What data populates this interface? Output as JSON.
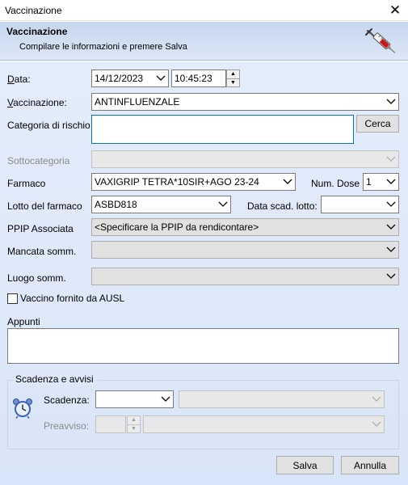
{
  "window": {
    "title": "Vaccinazione",
    "close_glyph": "✕"
  },
  "header": {
    "title": "Vaccinazione",
    "subtitle": "Compilare le informazioni e premere Salva",
    "icon": "syringe-icon",
    "accent": "#c00000"
  },
  "form": {
    "data": {
      "label": "Data:",
      "label_mnemonic": "D",
      "label_rest": "ata:",
      "date": "14/12/2023",
      "time": "10:45:23"
    },
    "vaccinazione": {
      "label": "Vaccinazione:",
      "label_mnemonic": "V",
      "label_rest": "accinazione:",
      "value": "ANTINFLUENZALE"
    },
    "categoria_rischio": {
      "label": "Categoria di rischio",
      "value": "",
      "search_button": "Cerca"
    },
    "sottocategoria": {
      "label": "Sottocategoria",
      "value": ""
    },
    "farmaco": {
      "label": "Farmaco",
      "value": "VAXIGRIP TETRA*10SIR+AGO 23-24"
    },
    "num_dose": {
      "label": "Num. Dose",
      "value": "1"
    },
    "lotto": {
      "label": "Lotto del farmaco",
      "value": "ASBD818"
    },
    "data_scad_lotto": {
      "label": "Data scad. lotto:",
      "value": ""
    },
    "ppip": {
      "label": "PPIP Associata",
      "value": "<Specificare la PPIP da rendicontare>"
    },
    "mancata_somm": {
      "label": "Mancata somm.",
      "value": ""
    },
    "luogo_somm": {
      "label": "Luogo somm.",
      "value": ""
    },
    "vaccino_ausl": {
      "label": "Vaccino fornito da AUSL",
      "checked": false
    },
    "appunti": {
      "label": "Appunti",
      "value": ""
    }
  },
  "scadenza_group": {
    "legend": "Scadenza e avvisi",
    "scadenza": {
      "label": "Scadenza:",
      "value": "",
      "unit": ""
    },
    "preavviso": {
      "label": "Preavviso:",
      "value": "",
      "unit": ""
    }
  },
  "buttons": {
    "save": "Salva",
    "cancel": "Annulla"
  }
}
